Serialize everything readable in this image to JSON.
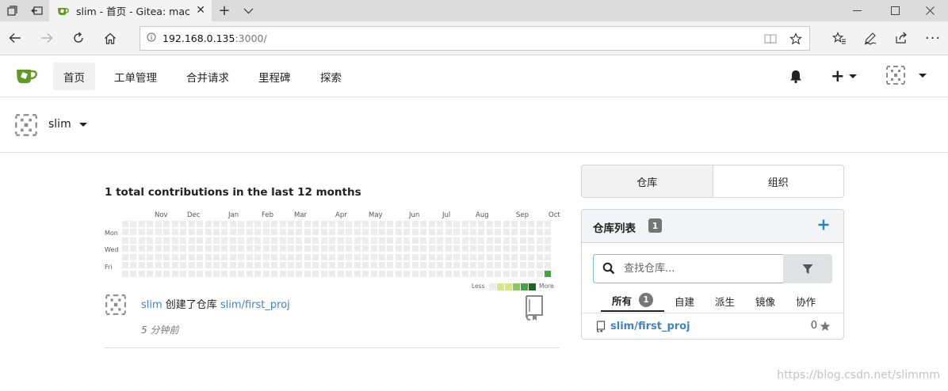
{
  "browser": {
    "tab_title": "slim - 首页 - Gitea: mac",
    "url_host": "192.168.0.135",
    "url_rest": ":3000/"
  },
  "header": {
    "nav": [
      {
        "label": "首页",
        "active": true
      },
      {
        "label": "工单管理",
        "active": false
      },
      {
        "label": "合并请求",
        "active": false
      },
      {
        "label": "里程碑",
        "active": false
      },
      {
        "label": "探索",
        "active": false
      }
    ],
    "add_symbol": "+"
  },
  "user": {
    "name": "slim"
  },
  "heatmap": {
    "title": "1 total contributions in the last 12 months",
    "months": [
      "Nov",
      "Dec",
      "Jan",
      "Feb",
      "Mar",
      "Apr",
      "May",
      "Jun",
      "Jul",
      "Aug",
      "Sep",
      "Oct"
    ],
    "days": [
      "Mon",
      "Wed",
      "Fri"
    ],
    "legend_less": "Less",
    "legend_more": "More",
    "legend_colors": [
      "#ececec",
      "#d6e685",
      "#8cc665",
      "#44a340",
      "#1e6823"
    ],
    "active_color": "#44a340"
  },
  "feed": {
    "user": "slim",
    "action": " 创建了仓库 ",
    "repo": "slim/first_proj",
    "time": "5 分钟前"
  },
  "sidebar": {
    "tabs": [
      {
        "label": "仓库",
        "active": true
      },
      {
        "label": "组织",
        "active": false
      }
    ],
    "repo_list_title": "仓库列表",
    "repo_count": "1",
    "search_placeholder": "查找仓库...",
    "filter_tabs": [
      {
        "label": "所有",
        "badge": "1",
        "active": true
      },
      {
        "label": "自建",
        "active": false
      },
      {
        "label": "派生",
        "active": false
      },
      {
        "label": "镜像",
        "active": false
      },
      {
        "label": "协作",
        "active": false
      }
    ],
    "repos": [
      {
        "name": "slim/first_proj",
        "stars": "0"
      }
    ]
  },
  "watermark": "https://blog.csdn.net/slimmm",
  "colors": {
    "link": "#4183c4",
    "primary": "#2185d0",
    "gitea_green": "#609926"
  }
}
